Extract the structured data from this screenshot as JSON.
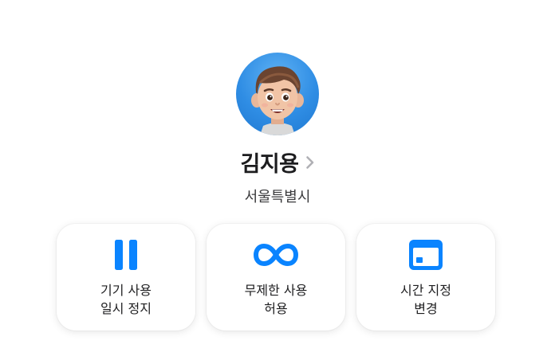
{
  "profile": {
    "avatar_icon": "memoji-avatar",
    "name": "김지용",
    "location": "서울특별시"
  },
  "actions": [
    {
      "icon": "pause-icon",
      "line1": "기기 사용",
      "line2": "일시 정지"
    },
    {
      "icon": "infinity-icon",
      "line1": "무제한 사용",
      "line2": "허용"
    },
    {
      "icon": "calendar-icon",
      "line1": "시간 지정",
      "line2": "변경"
    }
  ],
  "colors": {
    "accent": "#0a84ff",
    "avatar_bg": "#2f8de4",
    "chevron": "#b0b0b5"
  }
}
